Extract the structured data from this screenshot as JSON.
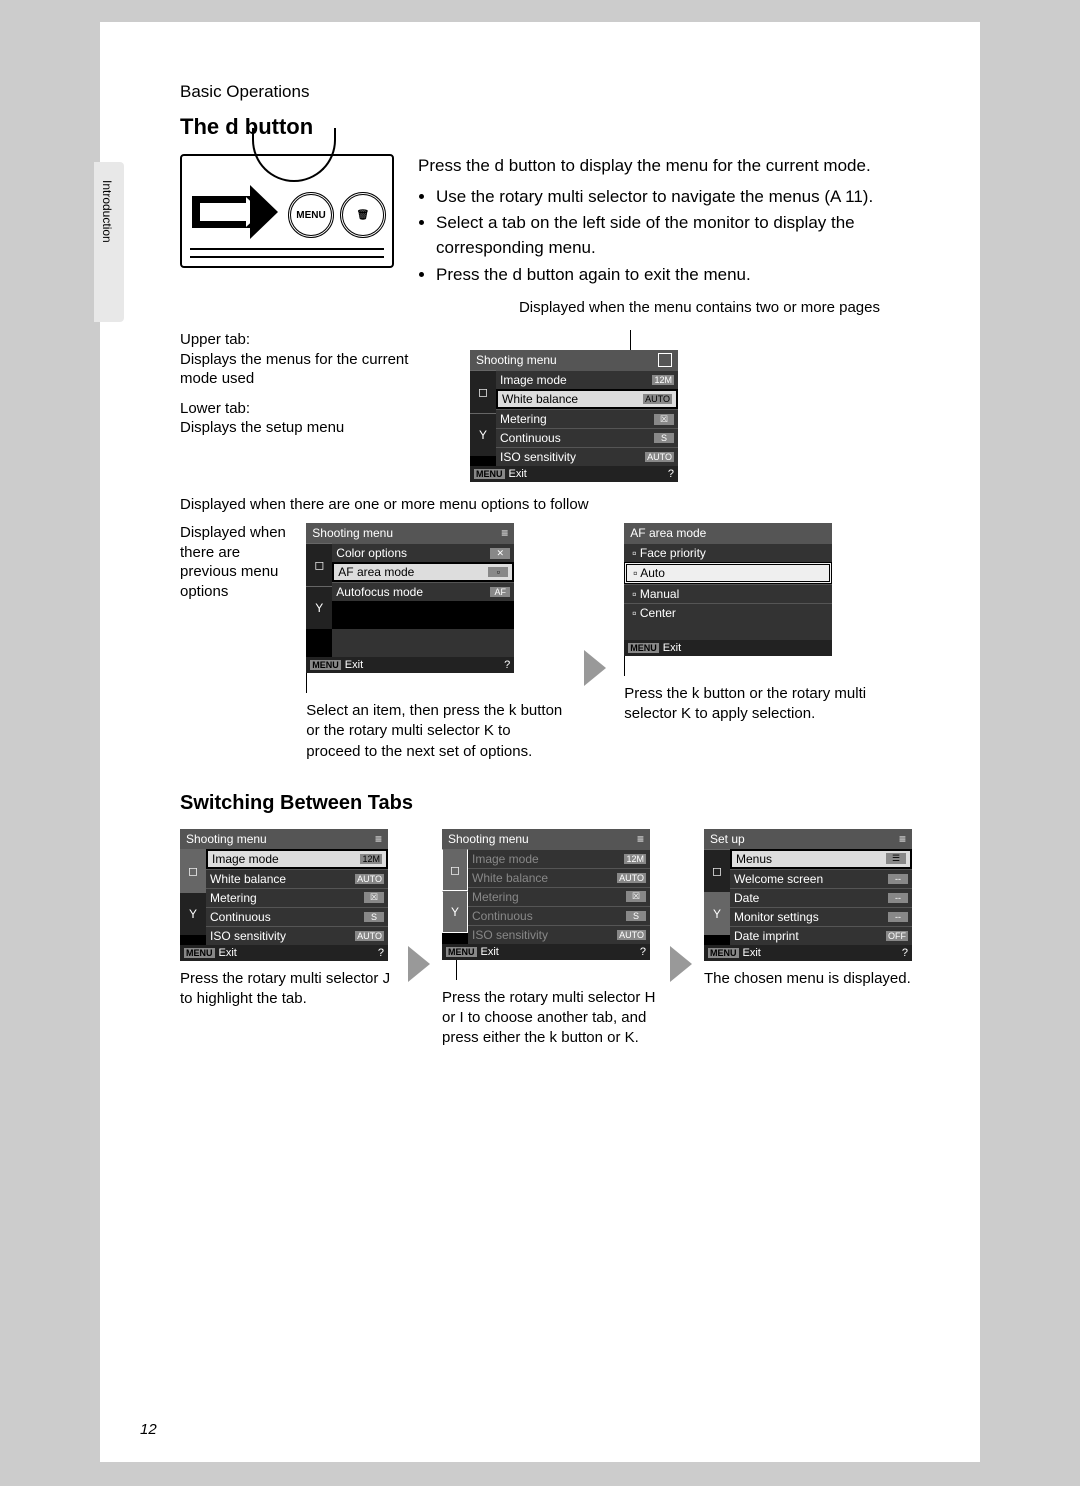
{
  "header": {
    "section": "Basic Operations",
    "sideLabel": "Introduction",
    "pageNum": "12"
  },
  "h1": "The d button",
  "intro": {
    "p1a": "Press the ",
    "p1b": "d",
    "p1c": " button to display the menu for the current mode.",
    "b1": "Use the rotary multi selector to navigate the menus (A 11).",
    "b2": "Select a tab on the left side of the monitor to display the corresponding menu.",
    "b3a": "Press the ",
    "b3b": "d",
    "b3c": " button again to exit the menu."
  },
  "illus": {
    "menuBtn": "MENU",
    "trashIcon": "🗑"
  },
  "anno": {
    "topRight": "Displayed when the menu contains two or more pages",
    "upper": "Upper tab:\nDisplays the menus for the current mode used",
    "lower": "Lower tab:\nDisplays the setup menu",
    "follow": "Displayed when there are one or more menu options to follow",
    "prev": "Displayed when there are previous menu options"
  },
  "screen1": {
    "title": "Shooting menu",
    "exit": "Exit",
    "menuTag": "MENU",
    "items": [
      {
        "label": "Image mode",
        "val": "12M"
      },
      {
        "label": "White balance",
        "val": "AUTO",
        "sel": true
      },
      {
        "label": "Metering",
        "val": "☒"
      },
      {
        "label": "Continuous",
        "val": "S"
      },
      {
        "label": "ISO sensitivity",
        "val": "AUTO"
      }
    ]
  },
  "screen2": {
    "title": "Shooting menu",
    "exit": "Exit",
    "menuTag": "MENU",
    "items": [
      {
        "label": "Color options",
        "val": "✕"
      },
      {
        "label": "AF area mode",
        "val": "▫",
        "sel": true
      },
      {
        "label": "Autofocus mode",
        "val": "AF"
      }
    ]
  },
  "screen3": {
    "title": "AF area mode",
    "exit": "Exit",
    "menuTag": "MENU",
    "items": [
      {
        "label": "Face priority"
      },
      {
        "label": "Auto",
        "sel": true
      },
      {
        "label": "Manual"
      },
      {
        "label": "Center"
      }
    ]
  },
  "cap2": "Select an item, then press the k button or the rotary multi selector K to proceed to the next set of options.",
  "cap3": "Press the k button or the rotary multi selector K to apply selection.",
  "h2": "Switching Between Tabs",
  "screenA": {
    "title": "Shooting menu",
    "exit": "Exit",
    "menuTag": "MENU",
    "items": [
      {
        "label": "Image mode",
        "val": "12M",
        "sel": true
      },
      {
        "label": "White balance",
        "val": "AUTO"
      },
      {
        "label": "Metering",
        "val": "☒"
      },
      {
        "label": "Continuous",
        "val": "S"
      },
      {
        "label": "ISO sensitivity",
        "val": "AUTO"
      }
    ]
  },
  "screenB": {
    "title": "Shooting menu",
    "exit": "Exit",
    "menuTag": "MENU",
    "items": [
      {
        "label": "Image mode",
        "val": "12M"
      },
      {
        "label": "White balance",
        "val": "AUTO"
      },
      {
        "label": "Metering",
        "val": "☒"
      },
      {
        "label": "Continuous",
        "val": "S"
      },
      {
        "label": "ISO sensitivity",
        "val": "AUTO"
      }
    ]
  },
  "screenC": {
    "title": "Set up",
    "exit": "Exit",
    "menuTag": "MENU",
    "items": [
      {
        "label": "Menus",
        "val": "☰",
        "sel": true
      },
      {
        "label": "Welcome screen",
        "val": "--"
      },
      {
        "label": "Date",
        "val": "--"
      },
      {
        "label": "Monitor settings",
        "val": "--"
      },
      {
        "label": "Date imprint",
        "val": "OFF"
      }
    ]
  },
  "capA": "Press the rotary multi selector J to highlight the tab.",
  "capB": "Press the rotary multi selector H or I to choose another tab, and press either the k button or K.",
  "capC": "The chosen menu is displayed."
}
